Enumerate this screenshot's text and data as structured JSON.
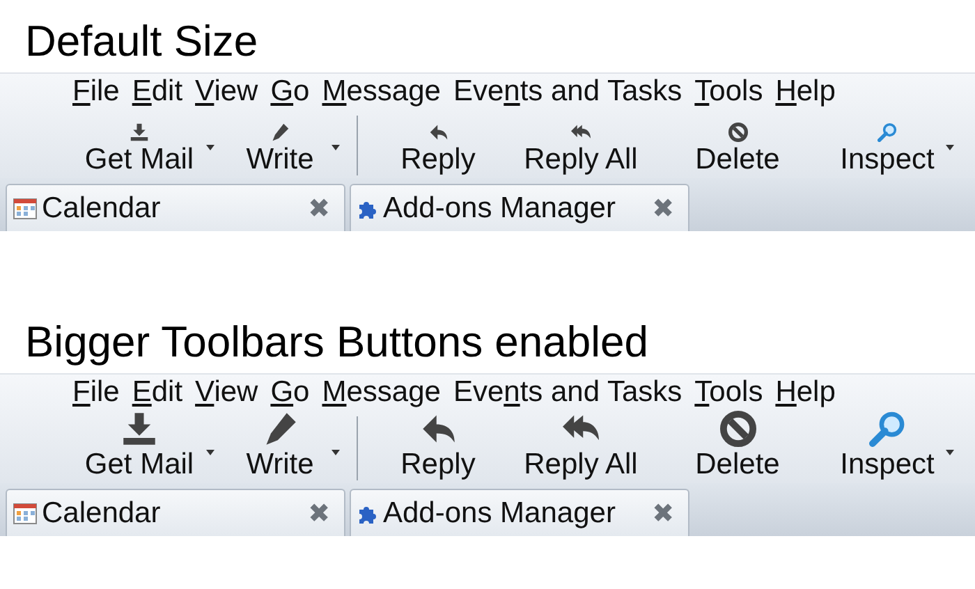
{
  "sections": [
    {
      "heading": "Default Size",
      "kind": "default",
      "menu": [
        {
          "mnemonic": "F",
          "end": "ile"
        },
        {
          "mnemonic": "E",
          "end": "dit"
        },
        {
          "mnemonic": "V",
          "end": "iew"
        },
        {
          "mnemonic": "G",
          "end": "o"
        },
        {
          "mnemonic": "M",
          "end": "essage"
        },
        {
          "start": "Eve",
          "mnemonic": "n",
          "end": "ts and Tasks"
        },
        {
          "mnemonic": "T",
          "end": "ools"
        },
        {
          "mnemonic": "H",
          "end": "elp"
        }
      ],
      "toolbar": [
        [
          {
            "label": "Get Mail",
            "dropdown": true
          },
          {
            "label": "Write",
            "dropdown": true
          }
        ],
        [
          {
            "label": "Reply",
            "dropdown": false
          },
          {
            "label": "Reply All",
            "dropdown": false
          },
          {
            "label": "Delete",
            "dropdown": false
          },
          {
            "label": "Inspect",
            "dropdown": true
          }
        ]
      ],
      "tabs": [
        {
          "label": "Calendar",
          "kind": "calendar",
          "close": "✖"
        },
        {
          "label": "Add-ons Manager",
          "kind": "addons",
          "close": "✖"
        }
      ]
    },
    {
      "heading": "Bigger Toolbars Buttons enabled",
      "kind": "big",
      "menu": [
        {
          "mnemonic": "F",
          "end": "ile"
        },
        {
          "mnemonic": "E",
          "end": "dit"
        },
        {
          "mnemonic": "V",
          "end": "iew"
        },
        {
          "mnemonic": "G",
          "end": "o"
        },
        {
          "mnemonic": "M",
          "end": "essage"
        },
        {
          "start": "Eve",
          "mnemonic": "n",
          "end": "ts and Tasks"
        },
        {
          "mnemonic": "T",
          "end": "ools"
        },
        {
          "mnemonic": "H",
          "end": "elp"
        }
      ],
      "toolbar": [
        [
          {
            "label": "Get Mail",
            "dropdown": true
          },
          {
            "label": "Write",
            "dropdown": true
          }
        ],
        [
          {
            "label": "Reply",
            "dropdown": false
          },
          {
            "label": "Reply All",
            "dropdown": false
          },
          {
            "label": "Delete",
            "dropdown": false
          },
          {
            "label": "Inspect",
            "dropdown": true
          }
        ]
      ],
      "tabs": [
        {
          "label": "Calendar",
          "kind": "calendar",
          "close": "✖"
        },
        {
          "label": "Add-ons Manager",
          "kind": "addons",
          "close": "✖"
        }
      ]
    }
  ]
}
